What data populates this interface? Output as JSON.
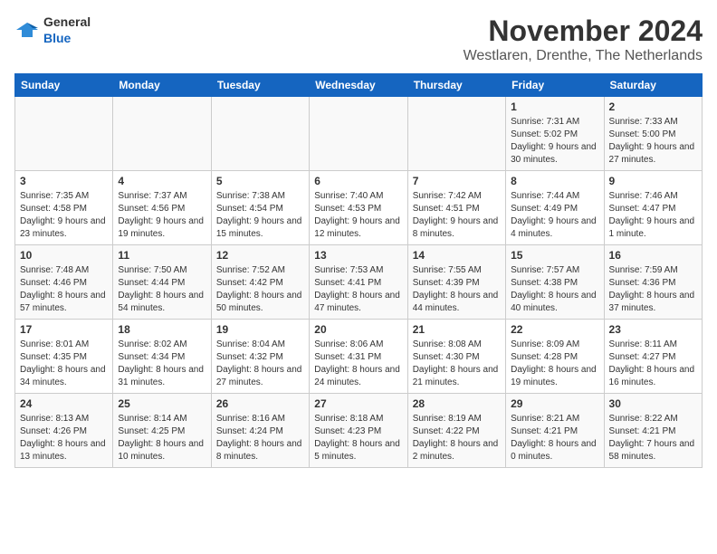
{
  "header": {
    "logo_general": "General",
    "logo_blue": "Blue",
    "month_title": "November 2024",
    "location": "Westlaren, Drenthe, The Netherlands"
  },
  "columns": [
    "Sunday",
    "Monday",
    "Tuesday",
    "Wednesday",
    "Thursday",
    "Friday",
    "Saturday"
  ],
  "weeks": [
    [
      {
        "day": "",
        "info": ""
      },
      {
        "day": "",
        "info": ""
      },
      {
        "day": "",
        "info": ""
      },
      {
        "day": "",
        "info": ""
      },
      {
        "day": "",
        "info": ""
      },
      {
        "day": "1",
        "info": "Sunrise: 7:31 AM\nSunset: 5:02 PM\nDaylight: 9 hours and 30 minutes."
      },
      {
        "day": "2",
        "info": "Sunrise: 7:33 AM\nSunset: 5:00 PM\nDaylight: 9 hours and 27 minutes."
      }
    ],
    [
      {
        "day": "3",
        "info": "Sunrise: 7:35 AM\nSunset: 4:58 PM\nDaylight: 9 hours and 23 minutes."
      },
      {
        "day": "4",
        "info": "Sunrise: 7:37 AM\nSunset: 4:56 PM\nDaylight: 9 hours and 19 minutes."
      },
      {
        "day": "5",
        "info": "Sunrise: 7:38 AM\nSunset: 4:54 PM\nDaylight: 9 hours and 15 minutes."
      },
      {
        "day": "6",
        "info": "Sunrise: 7:40 AM\nSunset: 4:53 PM\nDaylight: 9 hours and 12 minutes."
      },
      {
        "day": "7",
        "info": "Sunrise: 7:42 AM\nSunset: 4:51 PM\nDaylight: 9 hours and 8 minutes."
      },
      {
        "day": "8",
        "info": "Sunrise: 7:44 AM\nSunset: 4:49 PM\nDaylight: 9 hours and 4 minutes."
      },
      {
        "day": "9",
        "info": "Sunrise: 7:46 AM\nSunset: 4:47 PM\nDaylight: 9 hours and 1 minute."
      }
    ],
    [
      {
        "day": "10",
        "info": "Sunrise: 7:48 AM\nSunset: 4:46 PM\nDaylight: 8 hours and 57 minutes."
      },
      {
        "day": "11",
        "info": "Sunrise: 7:50 AM\nSunset: 4:44 PM\nDaylight: 8 hours and 54 minutes."
      },
      {
        "day": "12",
        "info": "Sunrise: 7:52 AM\nSunset: 4:42 PM\nDaylight: 8 hours and 50 minutes."
      },
      {
        "day": "13",
        "info": "Sunrise: 7:53 AM\nSunset: 4:41 PM\nDaylight: 8 hours and 47 minutes."
      },
      {
        "day": "14",
        "info": "Sunrise: 7:55 AM\nSunset: 4:39 PM\nDaylight: 8 hours and 44 minutes."
      },
      {
        "day": "15",
        "info": "Sunrise: 7:57 AM\nSunset: 4:38 PM\nDaylight: 8 hours and 40 minutes."
      },
      {
        "day": "16",
        "info": "Sunrise: 7:59 AM\nSunset: 4:36 PM\nDaylight: 8 hours and 37 minutes."
      }
    ],
    [
      {
        "day": "17",
        "info": "Sunrise: 8:01 AM\nSunset: 4:35 PM\nDaylight: 8 hours and 34 minutes."
      },
      {
        "day": "18",
        "info": "Sunrise: 8:02 AM\nSunset: 4:34 PM\nDaylight: 8 hours and 31 minutes."
      },
      {
        "day": "19",
        "info": "Sunrise: 8:04 AM\nSunset: 4:32 PM\nDaylight: 8 hours and 27 minutes."
      },
      {
        "day": "20",
        "info": "Sunrise: 8:06 AM\nSunset: 4:31 PM\nDaylight: 8 hours and 24 minutes."
      },
      {
        "day": "21",
        "info": "Sunrise: 8:08 AM\nSunset: 4:30 PM\nDaylight: 8 hours and 21 minutes."
      },
      {
        "day": "22",
        "info": "Sunrise: 8:09 AM\nSunset: 4:28 PM\nDaylight: 8 hours and 19 minutes."
      },
      {
        "day": "23",
        "info": "Sunrise: 8:11 AM\nSunset: 4:27 PM\nDaylight: 8 hours and 16 minutes."
      }
    ],
    [
      {
        "day": "24",
        "info": "Sunrise: 8:13 AM\nSunset: 4:26 PM\nDaylight: 8 hours and 13 minutes."
      },
      {
        "day": "25",
        "info": "Sunrise: 8:14 AM\nSunset: 4:25 PM\nDaylight: 8 hours and 10 minutes."
      },
      {
        "day": "26",
        "info": "Sunrise: 8:16 AM\nSunset: 4:24 PM\nDaylight: 8 hours and 8 minutes."
      },
      {
        "day": "27",
        "info": "Sunrise: 8:18 AM\nSunset: 4:23 PM\nDaylight: 8 hours and 5 minutes."
      },
      {
        "day": "28",
        "info": "Sunrise: 8:19 AM\nSunset: 4:22 PM\nDaylight: 8 hours and 2 minutes."
      },
      {
        "day": "29",
        "info": "Sunrise: 8:21 AM\nSunset: 4:21 PM\nDaylight: 8 hours and 0 minutes."
      },
      {
        "day": "30",
        "info": "Sunrise: 8:22 AM\nSunset: 4:21 PM\nDaylight: 7 hours and 58 minutes."
      }
    ]
  ]
}
